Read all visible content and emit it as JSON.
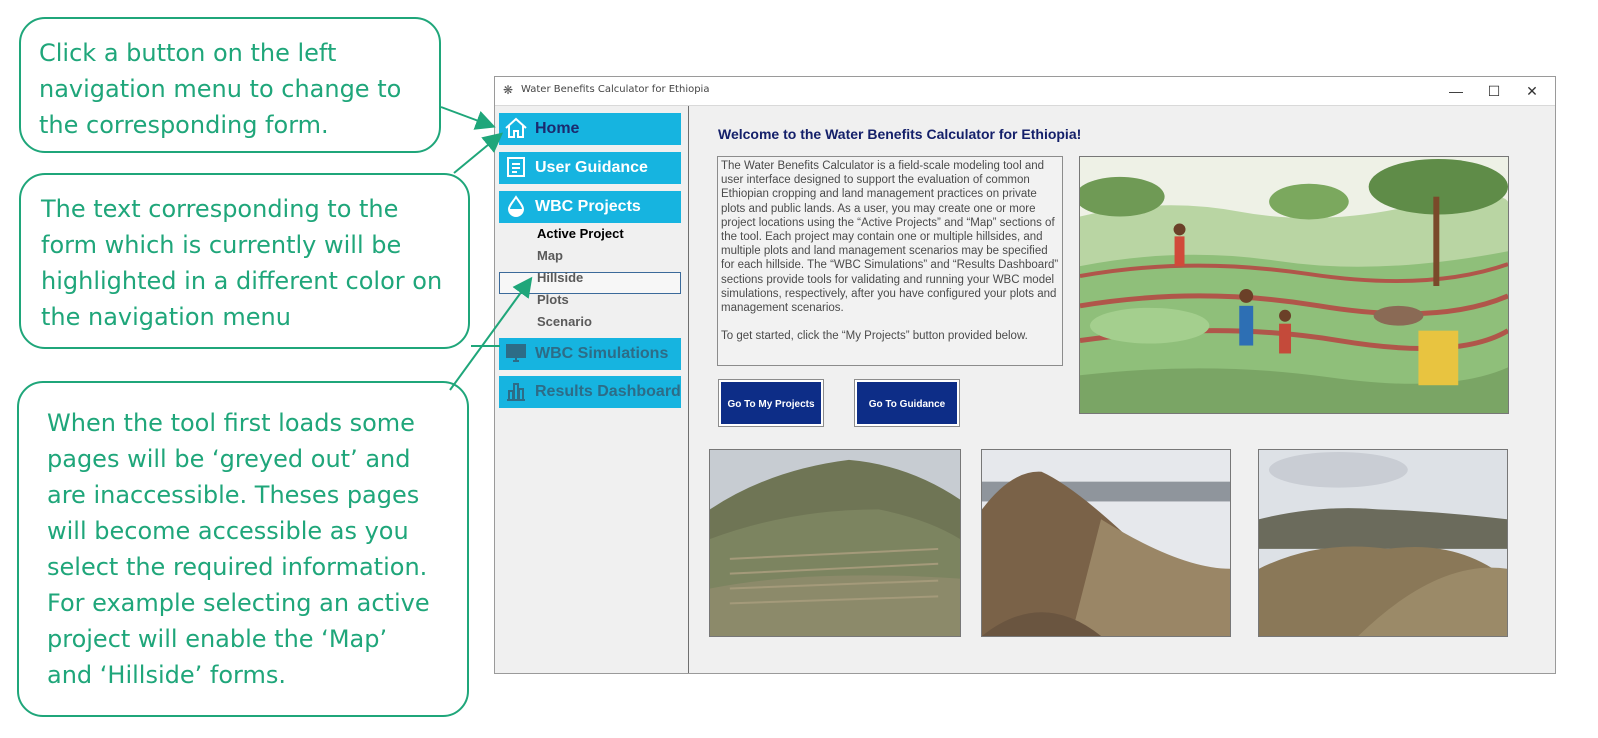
{
  "callouts": {
    "nav": "Click a button on the left navigation menu to change to the corresponding form.",
    "highlight": "The text corresponding to the form which is currently will be highlighted in a different color on the navigation menu",
    "greyed": "When the tool first loads some pages will be ‘greyed out’ and are inaccessible. Theses pages will become accessible as you select the required information. For example selecting an active project will enable the ‘Map’ and ‘Hillside’ forms."
  },
  "window": {
    "title": "Water Benefits Calculator for Ethiopia",
    "controls": {
      "minimize": "—",
      "maximize": "☐",
      "close": "✕"
    }
  },
  "nav": {
    "home": "Home",
    "guidance": "User Guidance",
    "projects": "WBC Projects",
    "sub_items": [
      "Active Project",
      "Map",
      "Hillside",
      "Plots",
      "Scenario"
    ],
    "simulations": "WBC Simulations",
    "results": "Results Dashboard",
    "icons": [
      "home-icon",
      "document-icon",
      "water-drop-icon",
      "monitor-icon",
      "bar-chart-icon"
    ]
  },
  "main": {
    "welcome": "Welcome to the Water Benefits Calculator for Ethiopia!",
    "intro_paragraph": "The Water Benefits Calculator is a field-scale modeling tool and user interface designed to support the evaluation of common Ethiopian cropping and land management practices on private plots and public lands. As a user, you may create one or more project locations using the “Active Projects” and “Map” sections of the tool.  Each project may contain one or multiple hillsides, and multiple plots and land management scenarios may be specified for each hillside. The “WBC Simulations” and “Results Dashboard” sections provide tools for validating and running your WBC model simulations, respectively, after you have configured your plots and management scenarios.",
    "get_started": "To get started, click the “My Projects” button provided below.",
    "button_projects": "Go To My Projects",
    "button_guidance": "Go To Guidance"
  },
  "colors": {
    "callout": "#1fa67a",
    "nav_button": "#16b4e0",
    "primary_button": "#0d2d87",
    "heading": "#14206a"
  }
}
